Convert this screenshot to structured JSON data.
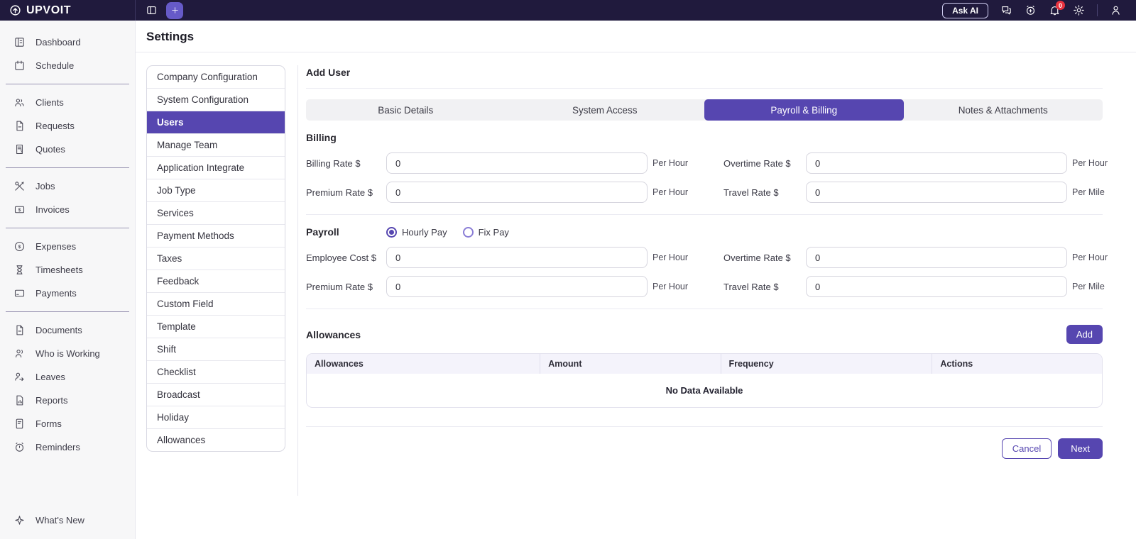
{
  "brand": {
    "name": "UPVOIT"
  },
  "topbar": {
    "ask_ai_label": "Ask AI",
    "notification_count": "0"
  },
  "page": {
    "title": "Settings"
  },
  "sidebar": {
    "groups": [
      {
        "items": [
          {
            "label": "Dashboard"
          },
          {
            "label": "Schedule"
          }
        ]
      },
      {
        "items": [
          {
            "label": "Clients"
          },
          {
            "label": "Requests"
          },
          {
            "label": "Quotes"
          }
        ]
      },
      {
        "items": [
          {
            "label": "Jobs"
          },
          {
            "label": "Invoices"
          }
        ]
      },
      {
        "items": [
          {
            "label": "Expenses"
          },
          {
            "label": "Timesheets"
          },
          {
            "label": "Payments"
          }
        ]
      },
      {
        "items": [
          {
            "label": "Documents"
          },
          {
            "label": "Who is Working"
          },
          {
            "label": "Leaves"
          },
          {
            "label": "Reports"
          },
          {
            "label": "Forms"
          },
          {
            "label": "Reminders"
          }
        ]
      }
    ],
    "footer_item": {
      "label": "What's New"
    }
  },
  "settings_menu": {
    "active": "Users",
    "items": [
      "Company Configuration",
      "System Configuration",
      "Users",
      "Manage Team",
      "Application Integrate",
      "Job Type",
      "Services",
      "Payment Methods",
      "Taxes",
      "Feedback",
      "Custom Field",
      "Template",
      "Shift",
      "Checklist",
      "Broadcast",
      "Holiday",
      "Allowances"
    ]
  },
  "form": {
    "title": "Add User",
    "tabs": [
      {
        "label": "Basic Details",
        "active": false
      },
      {
        "label": "System Access",
        "active": false
      },
      {
        "label": "Payroll & Billing",
        "active": true
      },
      {
        "label": "Notes & Attachments",
        "active": false
      }
    ],
    "billing": {
      "heading": "Billing",
      "rows": [
        {
          "left": {
            "label": "Billing Rate $",
            "value": "0",
            "suffix": "Per Hour"
          },
          "right": {
            "label": "Overtime Rate $",
            "value": "0",
            "suffix": "Per Hour"
          }
        },
        {
          "left": {
            "label": "Premium Rate $",
            "value": "0",
            "suffix": "Per Hour"
          },
          "right": {
            "label": "Travel Rate $",
            "value": "0",
            "suffix": "Per Mile"
          }
        }
      ]
    },
    "payroll": {
      "heading": "Payroll",
      "radio_options": [
        {
          "label": "Hourly Pay",
          "selected": true
        },
        {
          "label": "Fix Pay",
          "selected": false
        }
      ],
      "rows": [
        {
          "left": {
            "label": "Employee Cost $",
            "value": "0",
            "suffix": "Per Hour"
          },
          "right": {
            "label": "Overtime Rate $",
            "value": "0",
            "suffix": "Per Hour"
          }
        },
        {
          "left": {
            "label": "Premium Rate $",
            "value": "0",
            "suffix": "Per Hour"
          },
          "right": {
            "label": "Travel Rate $",
            "value": "0",
            "suffix": "Per Mile"
          }
        }
      ]
    },
    "allowances": {
      "heading": "Allowances",
      "add_label": "Add",
      "table": {
        "headers": [
          "Allowances",
          "Amount",
          "Frequency",
          "Actions"
        ],
        "empty_text": "No Data Available"
      }
    },
    "actions": {
      "cancel_label": "Cancel",
      "next_label": "Next"
    }
  },
  "colors": {
    "accent": "#5646b0",
    "accent_light": "#665ac8",
    "topbar_bg": "#201a3d",
    "badge_red": "#e8323f"
  }
}
